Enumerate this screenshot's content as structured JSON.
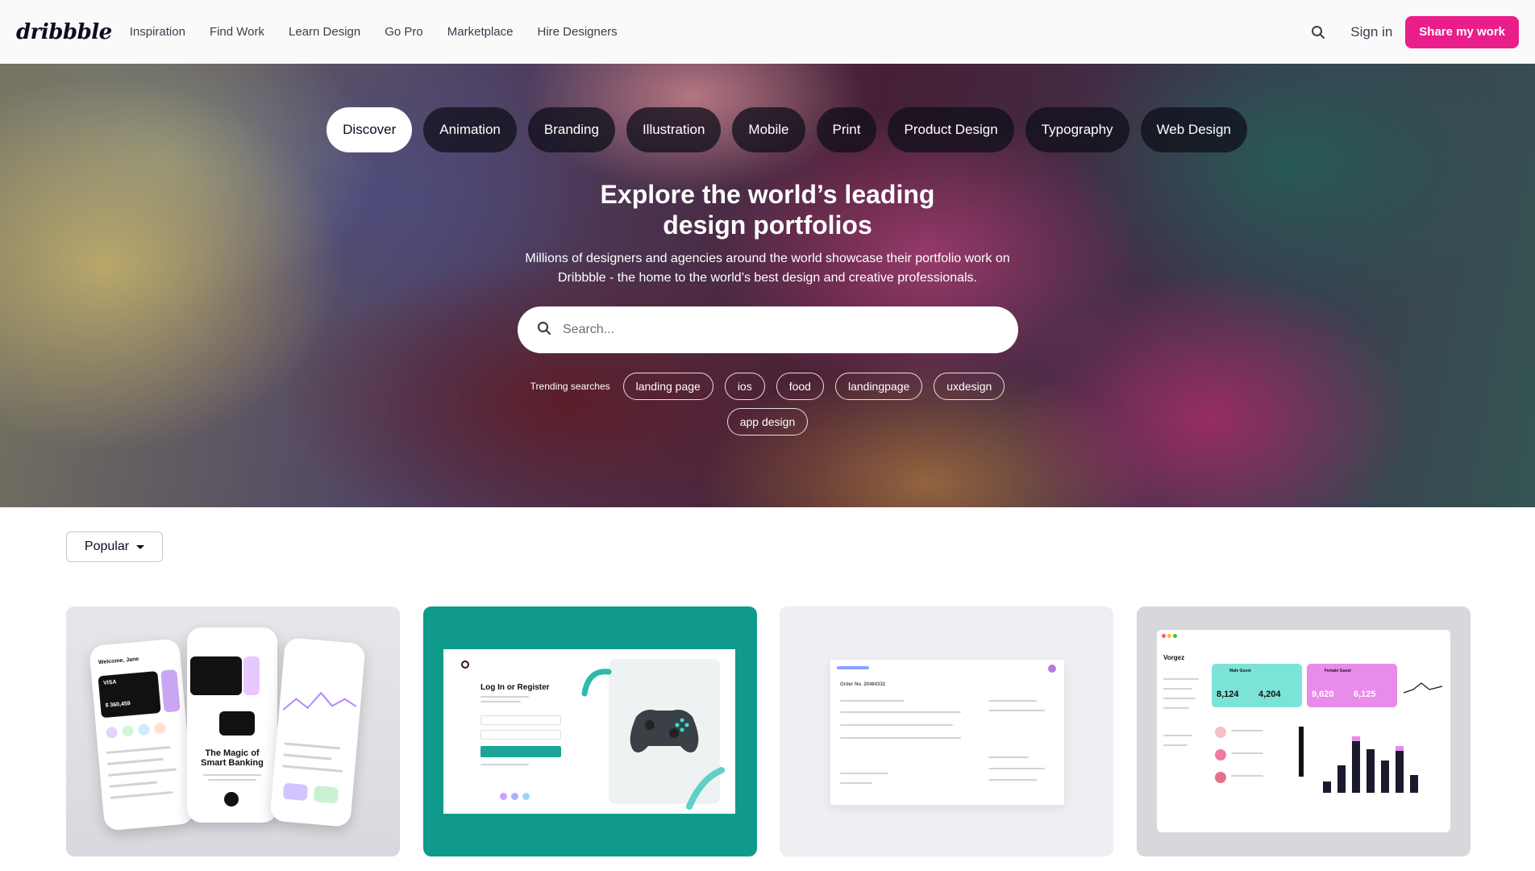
{
  "header": {
    "logo": "dribbble",
    "nav": [
      "Inspiration",
      "Find Work",
      "Learn Design",
      "Go Pro",
      "Marketplace",
      "Hire Designers"
    ],
    "sign_in": "Sign in",
    "share": "Share my work"
  },
  "hero": {
    "categories": [
      "Discover",
      "Animation",
      "Branding",
      "Illustration",
      "Mobile",
      "Print",
      "Product Design",
      "Typography",
      "Web Design"
    ],
    "active_category": "Discover",
    "title_line1": "Explore the world’s leading",
    "title_line2": "design portfolios",
    "subtitle_line1": "Millions of designers and agencies around the world showcase their portfolio work on",
    "subtitle_line2": "Dribbble - the home to the world’s best design and creative professionals.",
    "search_placeholder": "Search...",
    "trending_label": "Trending searches",
    "trending": [
      "landing page",
      "ios",
      "food",
      "landingpage",
      "uxdesign",
      "app design"
    ]
  },
  "filter": {
    "label": "Popular"
  },
  "shots": [
    {
      "name": "smart-banking-app",
      "headline_l1": "The Magic of",
      "headline_l2": "Smart Banking",
      "welcome": "Welcome, Jane",
      "card_brand": "VISA",
      "balance": "$ 360,459"
    },
    {
      "name": "login-register-gaming",
      "headline": "Log In or Register"
    },
    {
      "name": "order-dashboard",
      "order": "Order No. 20484332"
    },
    {
      "name": "hotel-dashboard",
      "brand": "Vorgez",
      "stats": [
        "8,124",
        "4,204",
        "9,620",
        "6,125"
      ],
      "labels": [
        "Male Guest",
        "Female Guest"
      ]
    }
  ],
  "colors": {
    "accent": "#ea1e8b",
    "teal": "#0f9a8c"
  }
}
